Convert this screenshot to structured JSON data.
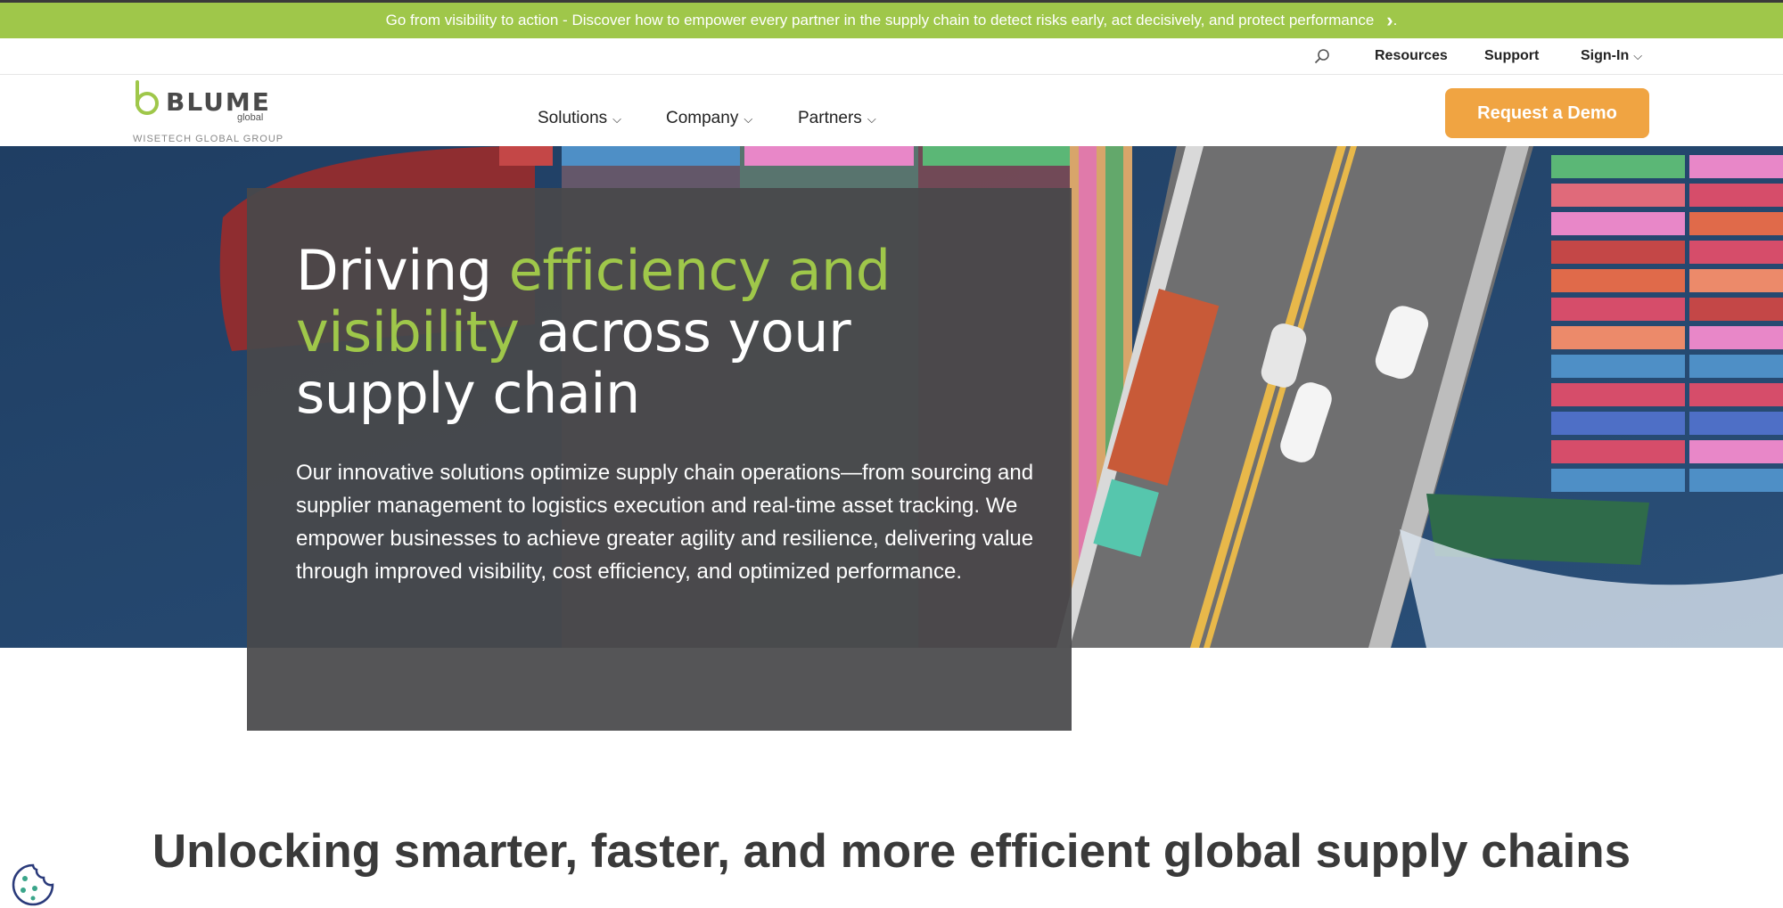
{
  "announcement": {
    "text": "Go from visibility to action - Discover how to empower every partner in the supply chain to detect risks early, act decisively, and protect performance",
    "trailing": "."
  },
  "utility_nav": {
    "resources": "Resources",
    "support": "Support",
    "signin": "Sign-In"
  },
  "brand": {
    "name": "BLUME",
    "sub": "global",
    "group": "WISETECH GLOBAL GROUP"
  },
  "main_nav": {
    "items": [
      {
        "label": "Solutions"
      },
      {
        "label": "Company"
      },
      {
        "label": "Partners"
      }
    ],
    "cta": "Request a Demo"
  },
  "hero": {
    "title_part1": "Driving ",
    "title_accent1": "efficiency and",
    "title_accent2": "visibility",
    "title_part2": " across your supply chain",
    "description": "Our innovative solutions optimize supply chain operations—from sourcing and supplier management to logistics execution and real-time asset tracking. We empower businesses to achieve greater agility and resilience, delivering value through improved visibility, cost efficiency, and optimized performance."
  },
  "section": {
    "heading": "Unlocking smarter, faster, and more efficient global supply chains"
  },
  "colors": {
    "brand_green": "#9fc74a",
    "cta_orange": "#f0a442",
    "panel_gray": "#48484a",
    "text_dark": "#3a3a3a"
  }
}
